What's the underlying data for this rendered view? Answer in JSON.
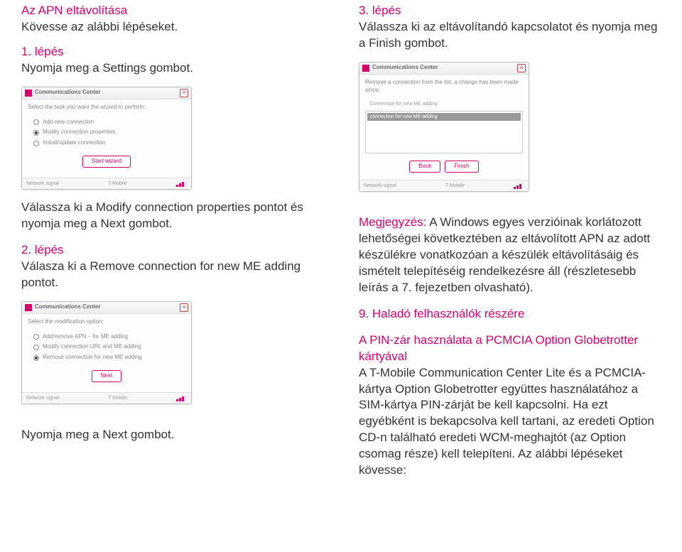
{
  "left": {
    "heading_line1": "Az APN eltávolítása",
    "heading_line2": "Kövesse az alábbi lépéseket.",
    "step1_label": "1. lépés",
    "step1_text": "Nyomja meg a Settings gombot.",
    "modify_text": "Válassza ki a Modify connection properties pontot és nyomja meg a Next gombot.",
    "step2_label": "2. lépés",
    "step2_text": "Válasza ki a Remove connection for new ME adding pontot.",
    "press_next": "Nyomja meg a Next gombot.",
    "dlg_title": "Communications Center",
    "dlg1_q": "Select the task you want the wizard to perform:",
    "dlg1_opt1": "Add new connection",
    "dlg1_opt2": "Modify connection properties",
    "dlg1_opt3": "Install/update connection",
    "dlg1_btn": "Start wizard",
    "dlg_status_left": "Network signal",
    "dlg_status_mid": "T-Mobile",
    "dlg2_q": "Select the modification option:",
    "dlg2_opt1": "Add/remove APN – for ME adding",
    "dlg2_opt2": "Modify connection URL and ME adding",
    "dlg2_opt3": "Remove connection for new ME adding",
    "dlg2_btn": "Next"
  },
  "right": {
    "step3_label": "3. lépés",
    "step3_text": "Válassza ki az eltávolítandó kapcsolatot és nyomja meg a Finish gombot.",
    "dlg3_q": "Remove a connection from the list, a change has been made since:",
    "dlg3_list_label": "Connection for new ME adding",
    "dlg3_row": "connection for new ME-adding",
    "dlg3_btn_back": "Back",
    "dlg3_btn_finish": "Finish",
    "note_lead": "Megjegyzés:",
    "note_body": " A Windows egyes verzióinak korlátozott lehetőségei következtében az eltávolított APN az adott készülékre vonatkozóan a készülék eltávolításáig és ismételt telepítéséig rendelkezésre áll (részletesebb leírás a 7. fejezetben olvasható).",
    "section9": "9. Haladó felhasználók részére",
    "pin_heading": "A PIN-zár használata a PCMCIA Option Globetrotter kártyával",
    "pin_body": "A T-Mobile Communication Center Lite és a PCMCIA-kártya Option Globetrotter együttes használatához a SIM-kártya PIN-zárját be kell kapcsolni. Ha ezt egyébként is bekapcsolva kell tartani, az eredeti Option CD-n található eredeti WCM-meghajtót (az Option csomag része) kell telepíteni. Az alábbi lépéseket kövesse:"
  }
}
